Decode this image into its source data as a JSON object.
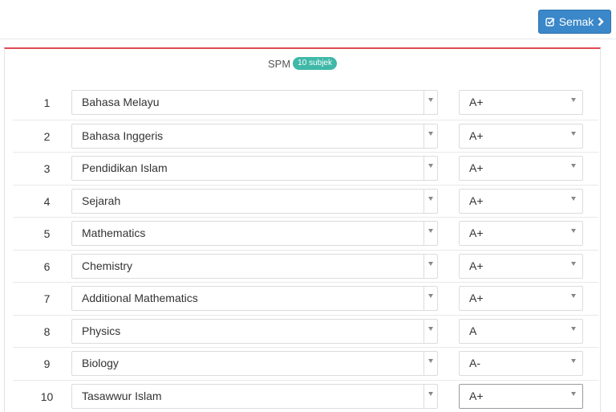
{
  "toolbar": {
    "semak_label": "Semak"
  },
  "panel": {
    "title": "SPM",
    "badge": "10 subjek"
  },
  "rows": [
    {
      "num": "1",
      "subject": "Bahasa Melayu",
      "grade": "A+"
    },
    {
      "num": "2",
      "subject": "Bahasa Inggeris",
      "grade": "A+"
    },
    {
      "num": "3",
      "subject": "Pendidikan Islam",
      "grade": "A+"
    },
    {
      "num": "4",
      "subject": "Sejarah",
      "grade": "A+"
    },
    {
      "num": "5",
      "subject": "Mathematics",
      "grade": "A+"
    },
    {
      "num": "6",
      "subject": "Chemistry",
      "grade": "A+"
    },
    {
      "num": "7",
      "subject": "Additional Mathematics",
      "grade": "A+"
    },
    {
      "num": "8",
      "subject": "Physics",
      "grade": "A"
    },
    {
      "num": "9",
      "subject": "Biology",
      "grade": "A-"
    },
    {
      "num": "10",
      "subject": "Tasawwur Islam",
      "grade": "A+"
    }
  ],
  "colors": {
    "accent": "#3a87c9",
    "panel_top": "#dd4b55",
    "badge": "#3fb8a8"
  }
}
